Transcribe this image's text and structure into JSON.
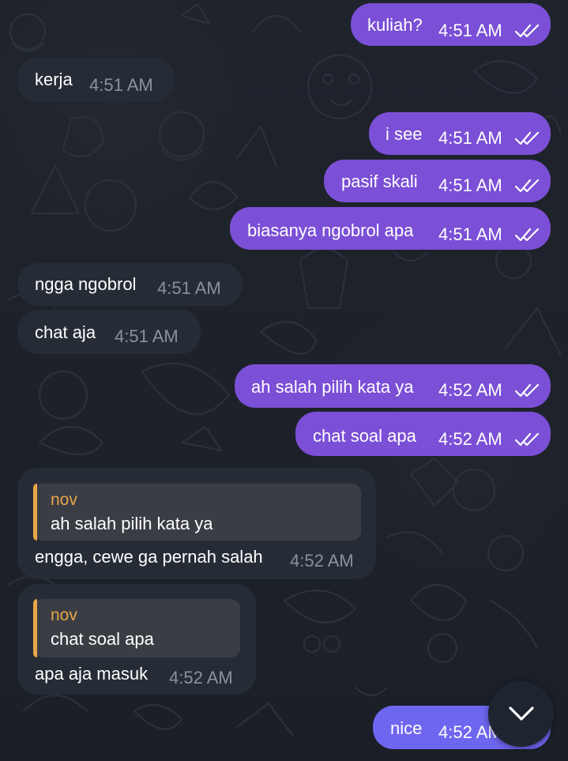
{
  "chat": {
    "messages": [
      {
        "direction": "out",
        "text": "kuliah?",
        "time": "4:51 AM",
        "status": "read"
      },
      {
        "direction": "in",
        "text": "kerja",
        "time": "4:51 AM"
      },
      {
        "direction": "out",
        "text": "i see",
        "time": "4:51 AM",
        "status": "read"
      },
      {
        "direction": "out",
        "text": "pasif skali",
        "time": "4:51 AM",
        "status": "read"
      },
      {
        "direction": "out",
        "text": "biasanya ngobrol apa",
        "time": "4:51 AM",
        "status": "read"
      },
      {
        "direction": "in",
        "text": "ngga ngobrol",
        "time": "4:51 AM"
      },
      {
        "direction": "in",
        "text": "chat aja",
        "time": "4:51 AM"
      },
      {
        "direction": "out",
        "text": "ah salah pilih kata ya",
        "time": "4:52 AM",
        "status": "read"
      },
      {
        "direction": "out",
        "text": "chat soal apa",
        "time": "4:52 AM",
        "status": "read"
      },
      {
        "direction": "in",
        "reply": {
          "name": "nov",
          "text": "ah salah pilih kata ya"
        },
        "text": "engga, cewe ga pernah salah",
        "time": "4:52 AM"
      },
      {
        "direction": "in",
        "reply": {
          "name": "nov",
          "text": "chat soal apa"
        },
        "text": "apa aja masuk",
        "time": "4:52 AM"
      },
      {
        "direction": "out",
        "text": "nice",
        "time": "4:52 AM",
        "status": "read"
      }
    ]
  },
  "scroll_button": {
    "icon": "chevron-down-icon"
  },
  "colors": {
    "background": "#1d2129",
    "outgoing_bubble": "#7b4fd6",
    "incoming_bubble": "#262c35",
    "reply_background": "#3a3d44",
    "reply_accent": "#e9a64a",
    "incoming_time": "#8a929d"
  }
}
